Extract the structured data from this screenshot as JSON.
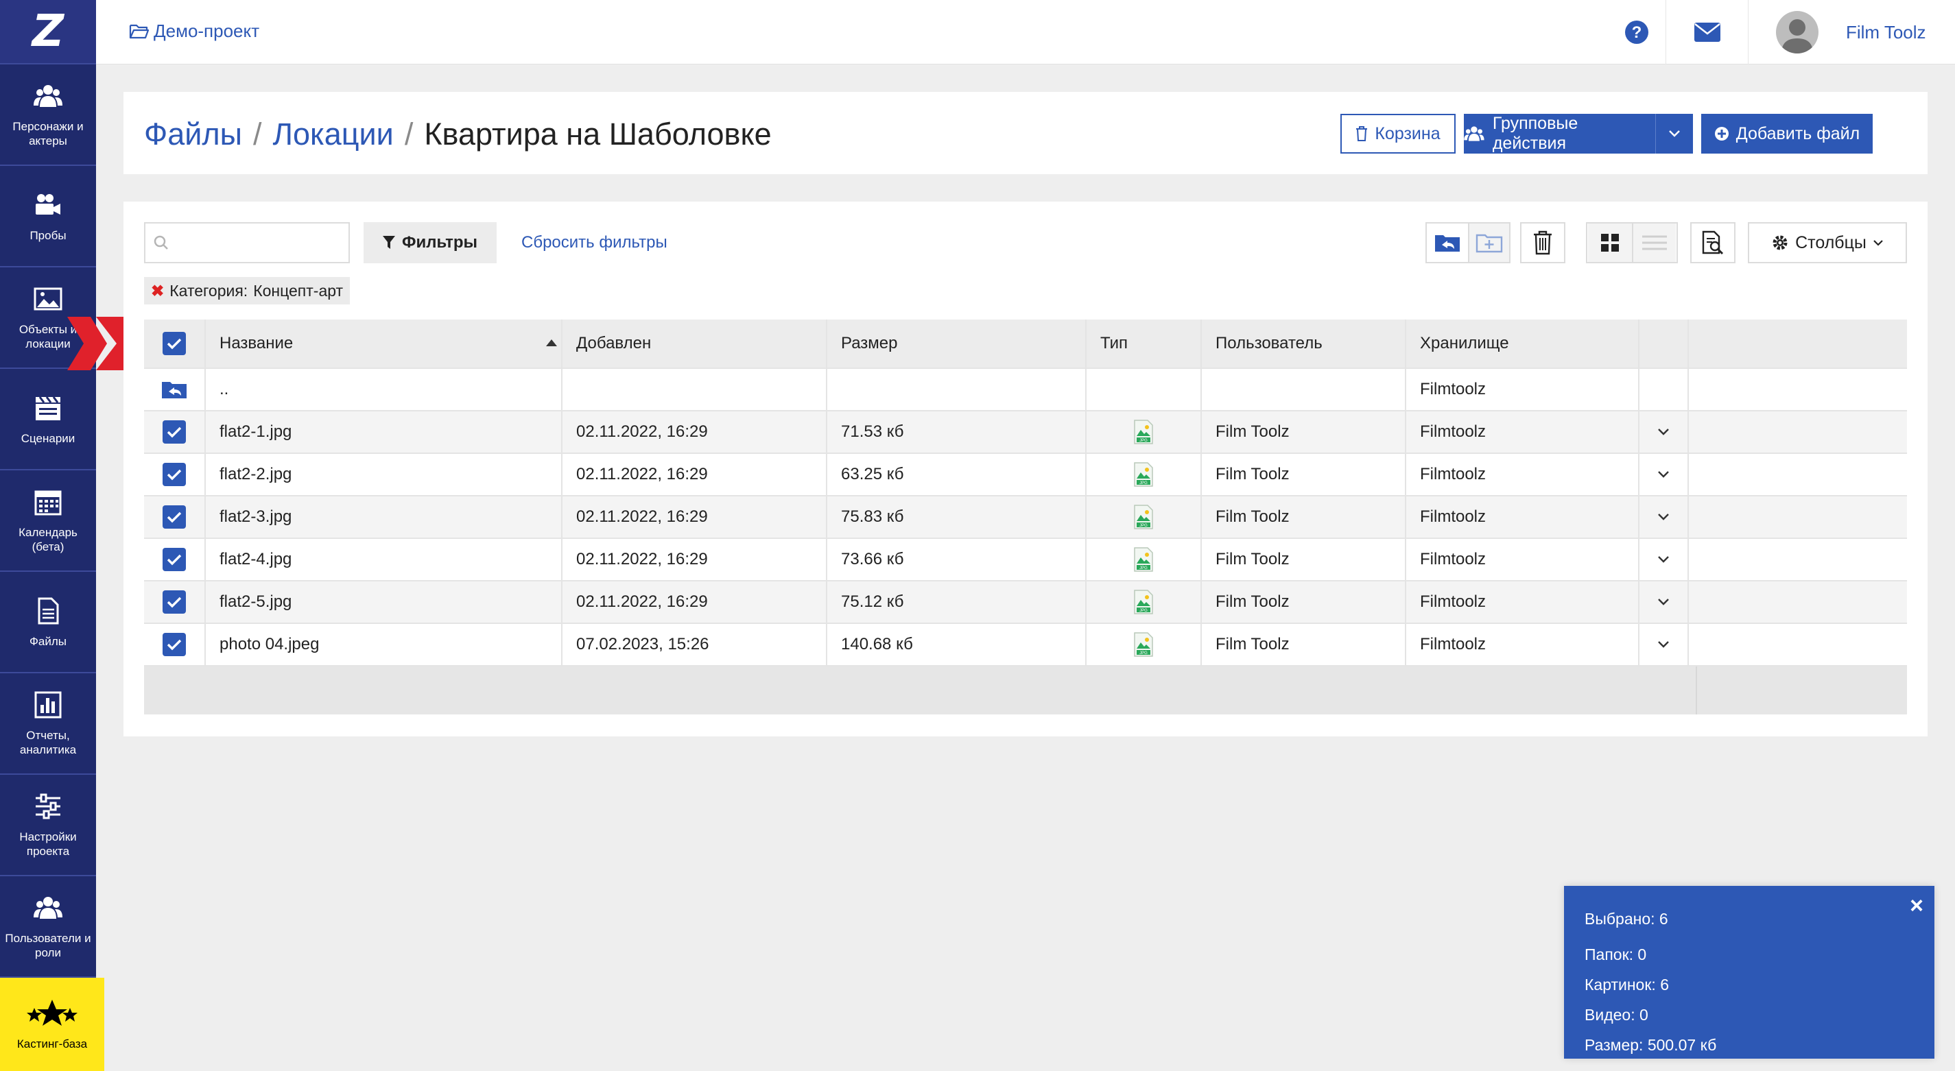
{
  "app": {
    "logo_letter": "Z",
    "project": "Демо-проект",
    "user_name": "Film Toolz"
  },
  "sidebar": {
    "items": [
      {
        "label": "Персонажи и\nактеры",
        "icon": "people-icon"
      },
      {
        "label": "Пробы",
        "icon": "camera-icon"
      },
      {
        "label": "Объекты и\nлокации",
        "icon": "image-icon"
      },
      {
        "label": "Сценарии",
        "icon": "clapperboard-icon"
      },
      {
        "label": "Календарь\n(бета)",
        "icon": "calendar-icon"
      },
      {
        "label": "Файлы",
        "icon": "file-icon"
      },
      {
        "label": "Отчеты,\nаналитика",
        "icon": "chart-icon"
      },
      {
        "label": "Настройки\nпроекта",
        "icon": "sliders-icon"
      },
      {
        "label": "Пользователи и\nроли",
        "icon": "users-icon"
      }
    ],
    "casting": {
      "label": "Кастинг-база",
      "icon": "stars-icon"
    }
  },
  "breadcrumb": {
    "files": "Файлы",
    "locations": "Локации",
    "current": "Квартира на Шаболовке",
    "sep": "/"
  },
  "actions": {
    "trash": "Корзина",
    "group": "Групповые действия",
    "add": "Добавить файл"
  },
  "toolbar": {
    "search_placeholder": "",
    "filters": "Фильтры",
    "reset": "Сбросить фильтры",
    "columns": "Столбцы"
  },
  "chip": {
    "label": "Категория:",
    "value": "Концепт-арт"
  },
  "table": {
    "headers": [
      "Название",
      "Добавлен",
      "Размер",
      "Тип",
      "Пользователь",
      "Хранилище"
    ],
    "parent": {
      "name": "..",
      "storage": "Filmtoolz"
    },
    "rows": [
      {
        "name": "flat2-1.jpg",
        "added": "02.11.2022, 16:29",
        "size": "71.53 кб",
        "user": "Film Toolz",
        "storage": "Filmtoolz"
      },
      {
        "name": "flat2-2.jpg",
        "added": "02.11.2022, 16:29",
        "size": "63.25 кб",
        "user": "Film Toolz",
        "storage": "Filmtoolz"
      },
      {
        "name": "flat2-3.jpg",
        "added": "02.11.2022, 16:29",
        "size": "75.83 кб",
        "user": "Film Toolz",
        "storage": "Filmtoolz"
      },
      {
        "name": "flat2-4.jpg",
        "added": "02.11.2022, 16:29",
        "size": "73.66 кб",
        "user": "Film Toolz",
        "storage": "Filmtoolz"
      },
      {
        "name": "flat2-5.jpg",
        "added": "02.11.2022, 16:29",
        "size": "75.12 кб",
        "user": "Film Toolz",
        "storage": "Filmtoolz"
      },
      {
        "name": "photo 04.jpeg",
        "added": "07.02.2023, 15:26",
        "size": "140.68 кб",
        "user": "Film Toolz",
        "storage": "Filmtoolz"
      }
    ]
  },
  "selection": {
    "selected": "Выбрано: 6",
    "folders": "Папок: 0",
    "images": "Картинок: 6",
    "videos": "Видео: 0",
    "size": "Размер: 500.07 кб",
    "close": "×"
  },
  "colors": {
    "accent": "#2d58b5",
    "sidebar": "#1f2a6c",
    "casting": "#ffe71a",
    "pointer": "#e0212b"
  }
}
